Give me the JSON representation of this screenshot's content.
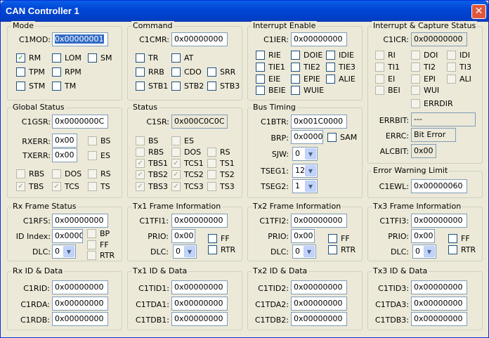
{
  "title": "CAN Controller 1",
  "icons": {
    "close": "close-icon",
    "check": "checkmark-icon",
    "dropdown": "chevron-down-icon"
  },
  "check_mark": "✓",
  "dd_arrow": "▼",
  "mode": {
    "title": "Mode",
    "label": "C1MOD:",
    "value": "0x00000001",
    "cb": [
      {
        "label": "RM",
        "checked": true
      },
      {
        "label": "LOM",
        "checked": false
      },
      {
        "label": "SM",
        "checked": false
      },
      {
        "label": "TPM",
        "checked": false
      },
      {
        "label": "RPM",
        "checked": false
      },
      {
        "label": "STM",
        "checked": false
      },
      {
        "label": "TM",
        "checked": false
      }
    ]
  },
  "command": {
    "title": "Command",
    "label": "C1CMR:",
    "value": "0x00000000",
    "cb": [
      {
        "label": "TR"
      },
      {
        "label": "AT"
      },
      {
        "label": "RRB"
      },
      {
        "label": "CDO"
      },
      {
        "label": "SRR"
      },
      {
        "label": "STB1"
      },
      {
        "label": "STB2"
      },
      {
        "label": "STB3"
      }
    ]
  },
  "ie": {
    "title": "Interrupt Enable",
    "label": "C1IER:",
    "value": "0x00000000",
    "cb": [
      {
        "label": "RIE"
      },
      {
        "label": "DOIE"
      },
      {
        "label": "IDIE"
      },
      {
        "label": "TIE1"
      },
      {
        "label": "TIE2"
      },
      {
        "label": "TIE3"
      },
      {
        "label": "EIE"
      },
      {
        "label": "EPIE"
      },
      {
        "label": "ALIE"
      },
      {
        "label": "BEIE"
      },
      {
        "label": "WUIE"
      }
    ]
  },
  "ic": {
    "title": "Interrupt & Capture Status",
    "label": "C1ICR:",
    "value": "0x00000000",
    "cb": [
      {
        "label": "RI"
      },
      {
        "label": "DOI"
      },
      {
        "label": "IDI"
      },
      {
        "label": "TI1"
      },
      {
        "label": "TI2"
      },
      {
        "label": "TI3"
      },
      {
        "label": "EI"
      },
      {
        "label": "EPI"
      },
      {
        "label": "ALI"
      },
      {
        "label": "BEI"
      },
      {
        "label": "WUI"
      },
      {
        "label": "ERRDIR"
      }
    ],
    "errbit_label": "ERRBIT:",
    "errbit": "---",
    "errc_label": "ERRC:",
    "errc": "Bit Error",
    "alcbit_label": "ALCBIT:",
    "alcbit": "0x00"
  },
  "gs": {
    "title": "Global Status",
    "label": "C1GSR:",
    "value": "0x0000000C",
    "rxerr_label": "RXERR:",
    "rxerr": "0x00",
    "txerr_label": "TXERR:",
    "txerr": "0x00",
    "cb": [
      {
        "label": "BS",
        "checked": false
      },
      {
        "label": "ES",
        "checked": false
      },
      {
        "label": "RBS",
        "checked": false
      },
      {
        "label": "DOS",
        "checked": false
      },
      {
        "label": "RS",
        "checked": false
      },
      {
        "label": "TBS",
        "checked": true
      },
      {
        "label": "TCS",
        "checked": true
      },
      {
        "label": "TS",
        "checked": false
      }
    ]
  },
  "st": {
    "title": "Status",
    "label": "C1SR:",
    "value": "0x000C0C0C",
    "cb": [
      {
        "label": "BS",
        "checked": false
      },
      {
        "label": "ES",
        "checked": false
      },
      {
        "label": "RBS",
        "checked": false
      },
      {
        "label": "DOS",
        "checked": false
      },
      {
        "label": "RS",
        "checked": false
      },
      {
        "label": "TBS1",
        "checked": true
      },
      {
        "label": "TCS1",
        "checked": true
      },
      {
        "label": "TS1",
        "checked": false
      },
      {
        "label": "TBS2",
        "checked": true
      },
      {
        "label": "TCS2",
        "checked": true
      },
      {
        "label": "TS2",
        "checked": false
      },
      {
        "label": "TBS3",
        "checked": true
      },
      {
        "label": "TCS3",
        "checked": true
      },
      {
        "label": "TS3",
        "checked": false
      }
    ]
  },
  "bt": {
    "title": "Bus Timing",
    "label": "C1BTR:",
    "value": "0x001C0000",
    "brp_label": "BRP:",
    "brp": "0x0000",
    "sam": "SAM",
    "sjw_label": "SJW:",
    "sjw": "0",
    "tseg1_label": "TSEG1:",
    "tseg1": "12",
    "tseg2_label": "TSEG2:",
    "tseg2": "1"
  },
  "ewl": {
    "title": "Error Warning Limit",
    "label": "C1EWL:",
    "value": "0x00000060"
  },
  "rxf": {
    "title": "Rx Frame Status",
    "label": "C1RFS:",
    "value": "0x00000000",
    "idindex_label": "ID Index:",
    "idindex": "0x0000",
    "bp": "BP",
    "ff": "FF",
    "rtr": "RTR",
    "dlc_label": "DLC:",
    "dlc": "0"
  },
  "tx1f": {
    "title": "Tx1 Frame Information",
    "label": "C1TFI1:",
    "value": "0x00000000",
    "prio_label": "PRIO:",
    "prio": "0x00",
    "ff": "FF",
    "rtr": "RTR",
    "dlc_label": "DLC:",
    "dlc": "0"
  },
  "tx2f": {
    "title": "Tx2 Frame Information",
    "label": "C1TFI2:",
    "value": "0x00000000",
    "prio_label": "PRIO:",
    "prio": "0x00",
    "ff": "FF",
    "rtr": "RTR",
    "dlc_label": "DLC:",
    "dlc": "0"
  },
  "tx3f": {
    "title": "Tx3 Frame Information",
    "label": "C1TFI3:",
    "value": "0x00000000",
    "prio_label": "PRIO:",
    "prio": "0x00",
    "ff": "FF",
    "rtr": "RTR",
    "dlc_label": "DLC:",
    "dlc": "0"
  },
  "rxd": {
    "title": "Rx ID & Data",
    "f": [
      {
        "label": "C1RID:",
        "value": "0x00000000"
      },
      {
        "label": "C1RDA:",
        "value": "0x00000000"
      },
      {
        "label": "C1RDB:",
        "value": "0x00000000"
      }
    ]
  },
  "tx1d": {
    "title": "Tx1 ID & Data",
    "f": [
      {
        "label": "C1TID1:",
        "value": "0x00000000"
      },
      {
        "label": "C1TDA1:",
        "value": "0x00000000"
      },
      {
        "label": "C1TDB1:",
        "value": "0x00000000"
      }
    ]
  },
  "tx2d": {
    "title": "Tx2 ID & Data",
    "f": [
      {
        "label": "C1TID2:",
        "value": "0x00000000"
      },
      {
        "label": "C1TDA2:",
        "value": "0x00000000"
      },
      {
        "label": "C1TDB2:",
        "value": "0x00000000"
      }
    ]
  },
  "tx3d": {
    "title": "Tx3 ID & Data",
    "f": [
      {
        "label": "C1TID3:",
        "value": "0x00000000"
      },
      {
        "label": "C1TDA3:",
        "value": "0x00000000"
      },
      {
        "label": "C1TDB3:",
        "value": "0x00000000"
      }
    ]
  }
}
